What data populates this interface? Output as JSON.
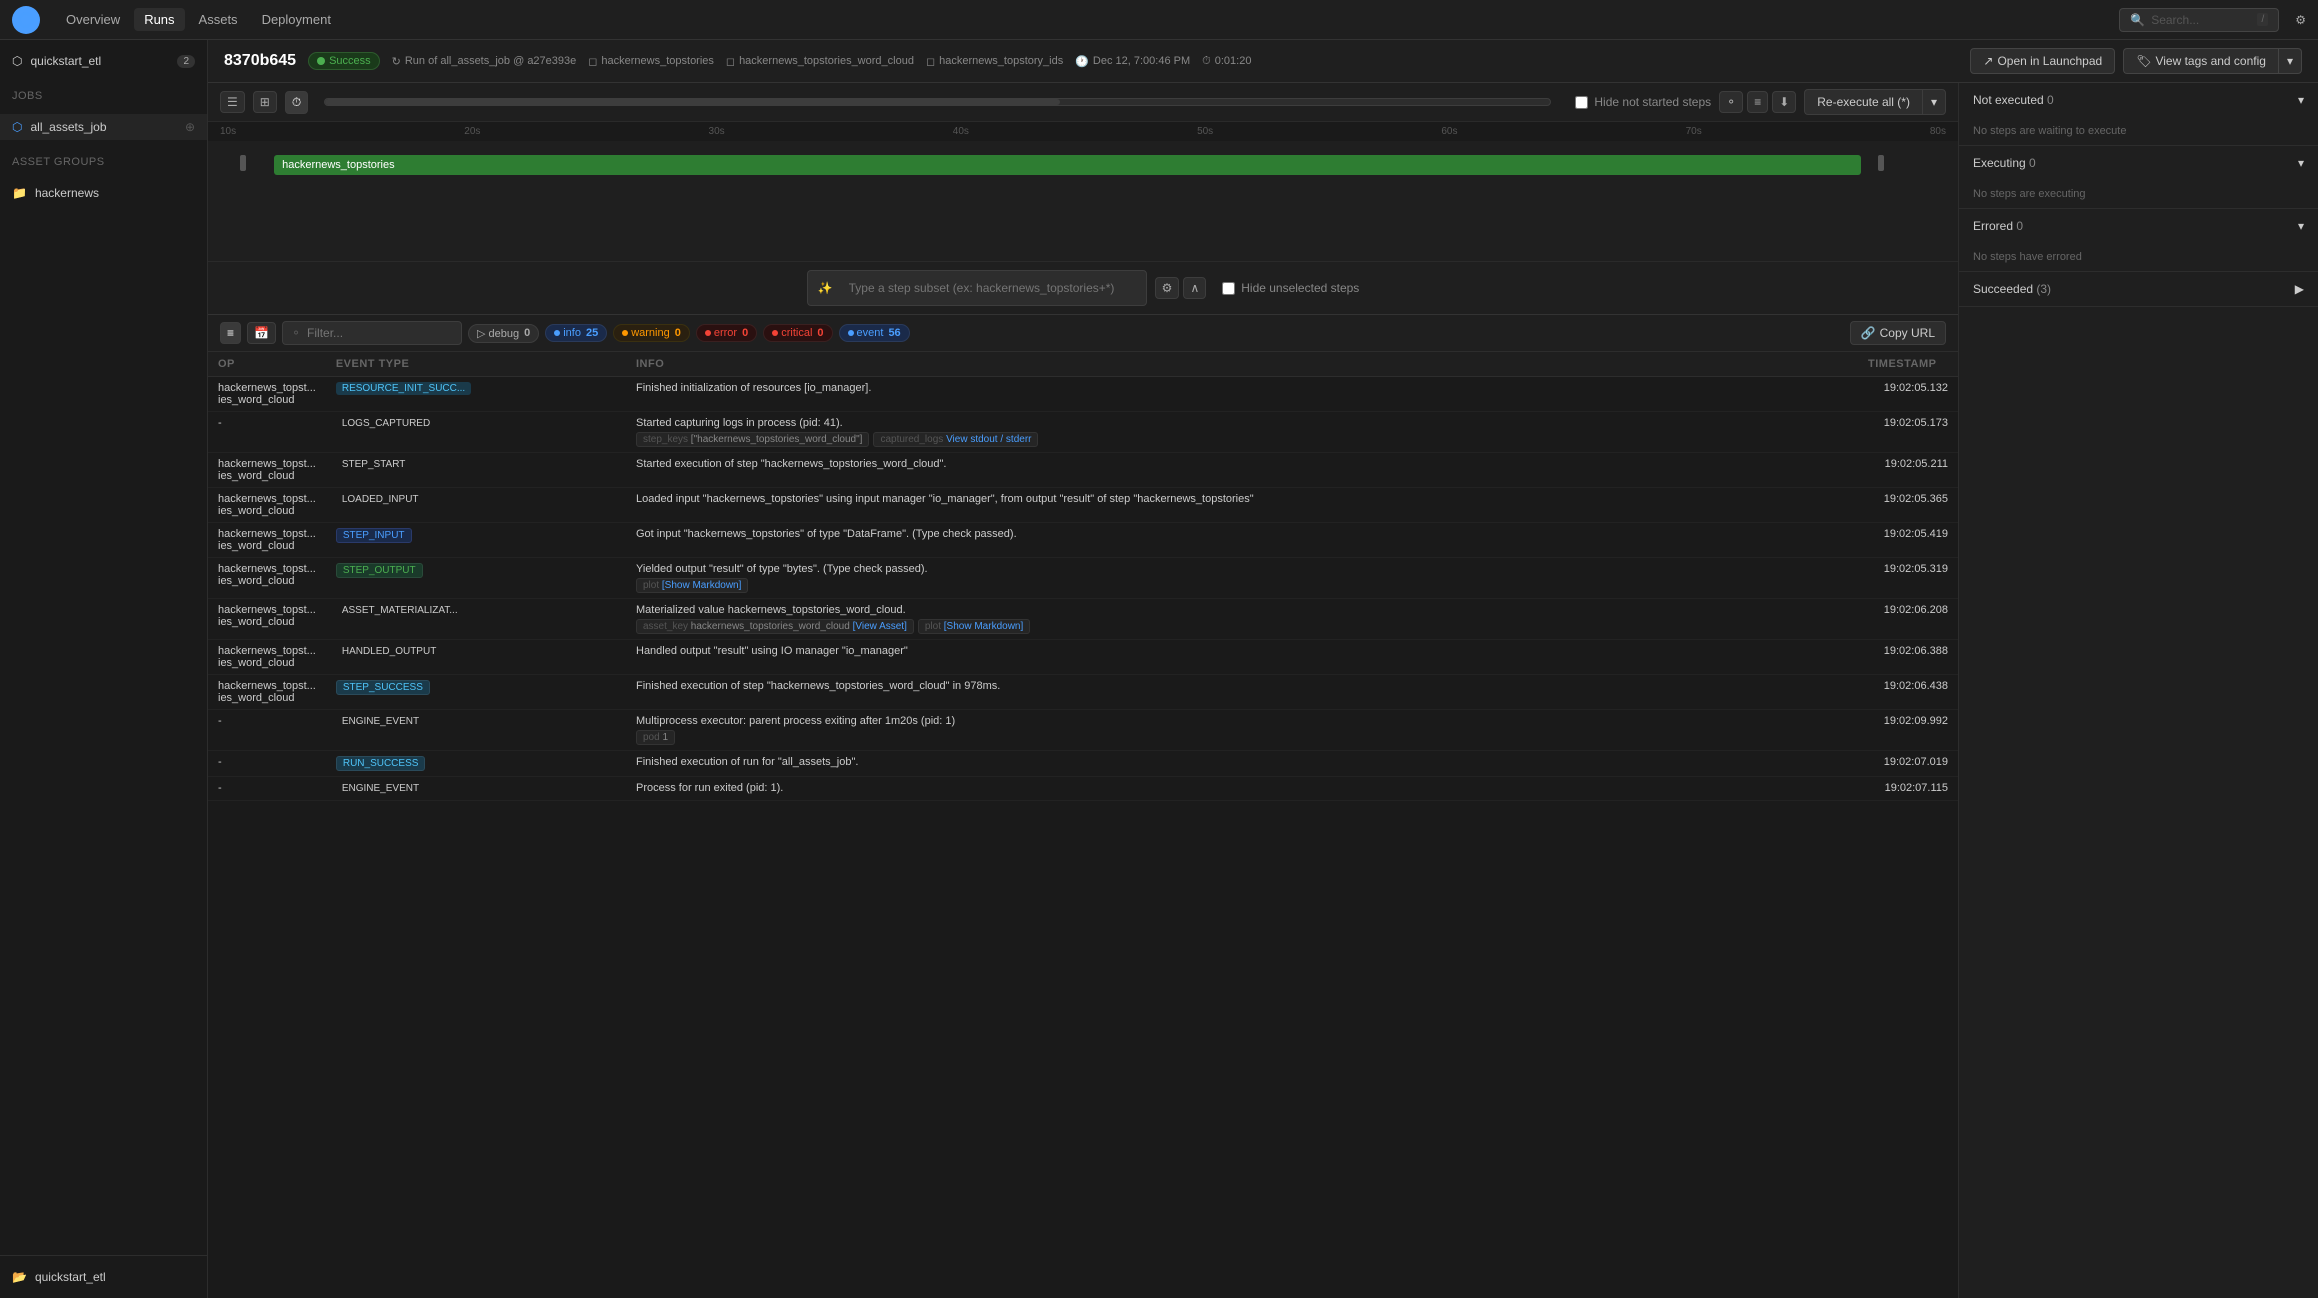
{
  "app": {
    "logo": "🔷",
    "nav_items": [
      "Overview",
      "Runs",
      "Assets",
      "Deployment"
    ],
    "active_nav": "Runs",
    "search_placeholder": "Search...",
    "search_shortcut": "/"
  },
  "sidebar": {
    "workspace": "quickstart_etl",
    "workspace_badge": "2",
    "jobs_label": "Jobs",
    "jobs": [
      {
        "name": "all_assets_job",
        "icon": "⬡"
      }
    ],
    "asset_groups_label": "Asset Groups",
    "asset_groups": [
      {
        "name": "hackernews"
      }
    ],
    "bottom_workspace": "quickstart_etl"
  },
  "run": {
    "id": "8370b645",
    "status": "Success",
    "job": "Run of all_assets_job @ a27e393e",
    "assets": [
      "hackernews_topstories",
      "hackernews_topstories_word_cloud",
      "hackernews_topstory_ids"
    ],
    "date": "Dec 12, 7:00:46 PM",
    "duration": "0:01:20",
    "open_launchpad_label": "Open in Launchpad",
    "view_tags_label": "View tags and config",
    "re_execute_label": "Re-execute all (*)"
  },
  "timeline": {
    "toolbar": {
      "btn_list": "☰",
      "btn_grid": "⊞",
      "btn_clock": "⏱",
      "hide_not_started": "Hide not started steps"
    },
    "ruler_marks": [
      "10s",
      "20s",
      "30s",
      "40s",
      "50s",
      "60s",
      "70s",
      "80s"
    ],
    "bars": [
      {
        "name": "hackernews_topstories",
        "color": "green",
        "left_pct": 2,
        "width_pct": 95
      }
    ],
    "step_search": {
      "placeholder": "Type a step subset (ex: hackernews_topstories+*)",
      "hide_unselected": "Hide unselected steps"
    }
  },
  "right_panel": {
    "sections": [
      {
        "label": "Not executed",
        "count": 0,
        "body": "No steps are waiting to execute"
      },
      {
        "label": "Executing",
        "count": 0,
        "body": "No steps are executing"
      },
      {
        "label": "Errored",
        "count": 0,
        "body": "No steps have errored"
      },
      {
        "label": "Succeeded",
        "count": 3,
        "body": ""
      }
    ]
  },
  "logs": {
    "filter_placeholder": "Filter...",
    "levels": [
      {
        "name": "debug",
        "count": 0
      },
      {
        "name": "info",
        "count": 25
      },
      {
        "name": "warning",
        "count": 0
      },
      {
        "name": "error",
        "count": 0
      },
      {
        "name": "critical",
        "count": 0
      },
      {
        "name": "event",
        "count": 56
      }
    ],
    "copy_url": "Copy URL",
    "columns": [
      "OP",
      "EVENT TYPE",
      "INFO",
      "TIMESTAMP"
    ],
    "rows": [
      {
        "op": "hackernews_topst... ies_word_cloud",
        "event_type": "RESOURCE_INIT_SUCC...",
        "event_badge": "resource",
        "info": "Finished initialization of resources [io_manager].",
        "info_sub": [],
        "timestamp": "19:02:05.132"
      },
      {
        "op": "-",
        "event_type": "LOGS_CAPTURED",
        "event_badge": "logs",
        "info": "Started capturing logs in process (pid: 41).",
        "info_sub": [
          {
            "key": "step_keys",
            "value": "[\"hackernews_topstories_word_cloud\"]"
          },
          {
            "key": "captured_logs",
            "value": "View stdout / stderr",
            "link": true
          }
        ],
        "timestamp": "19:02:05.173"
      },
      {
        "op": "hackernews_topst... ies_word_cloud",
        "event_type": "STEP_START",
        "event_badge": "step-start",
        "info": "Started execution of step \"hackernews_topstories_word_cloud\".",
        "info_sub": [],
        "timestamp": "19:02:05.211"
      },
      {
        "op": "hackernews_topst... ies_word_cloud",
        "event_type": "LOADED_INPUT",
        "event_badge": "loaded",
        "info": "Loaded input \"hackernews_topstories\" using input manager \"io_manager\", from output \"result\" of step \"hackernews_topstories\"",
        "info_sub": [],
        "timestamp": "19:02:05.365"
      },
      {
        "op": "hackernews_topst... ies_word_cloud",
        "event_type": "STEP_INPUT",
        "event_badge": "step-input",
        "info": "Got input \"hackernews_topstories\" of type \"DataFrame\". (Type check passed).",
        "info_sub": [],
        "timestamp": "19:02:05.419"
      },
      {
        "op": "hackernews_topst... ies_word_cloud",
        "event_type": "STEP_OUTPUT",
        "event_badge": "step-output",
        "info": "Yielded output \"result\" of type \"bytes\". (Type check passed).",
        "info_sub": [
          {
            "key": "plot",
            "value": "[Show Markdown]",
            "link": true
          }
        ],
        "timestamp": "19:02:05.319"
      },
      {
        "op": "hackernews_topst... ies_word_cloud",
        "event_type": "ASSET_MATERIALIZAT...",
        "event_badge": "asset",
        "info": "Materialized value hackernews_topstories_word_cloud.",
        "info_sub": [
          {
            "key": "asset_key",
            "value": "hackernews_topstories_word_cloud",
            "extra_link": "[View Asset]"
          },
          {
            "key": "plot",
            "value": "[Show Markdown]",
            "link": true
          }
        ],
        "timestamp": "19:02:06.208"
      },
      {
        "op": "hackernews_topst... ies_word_cloud",
        "event_type": "HANDLED_OUTPUT",
        "event_badge": "handled",
        "info": "Handled output \"result\" using IO manager \"io_manager\"",
        "info_sub": [],
        "timestamp": "19:02:06.388"
      },
      {
        "op": "hackernews_topst... ies_word_cloud",
        "event_type": "STEP_SUCCESS",
        "event_badge": "step-success",
        "info": "Finished execution of step \"hackernews_topstories_word_cloud\" in 978ms.",
        "info_sub": [],
        "timestamp": "19:02:06.438"
      },
      {
        "op": "-",
        "event_type": "ENGINE_EVENT",
        "event_badge": "engine",
        "info": "Multiprocess executor: parent process exiting after 1m20s (pid: 1)",
        "info_sub": [
          {
            "key": "pod",
            "value": "1"
          }
        ],
        "timestamp": "19:02:09.992"
      },
      {
        "op": "-",
        "event_type": "RUN_SUCCESS",
        "event_badge": "run-success",
        "info": "Finished execution of run for \"all_assets_job\".",
        "info_sub": [],
        "timestamp": "19:02:07.019"
      },
      {
        "op": "-",
        "event_type": "ENGINE_EVENT",
        "event_badge": "engine",
        "info": "Process for run exited (pid: 1).",
        "info_sub": [],
        "timestamp": "19:02:07.115"
      }
    ]
  }
}
